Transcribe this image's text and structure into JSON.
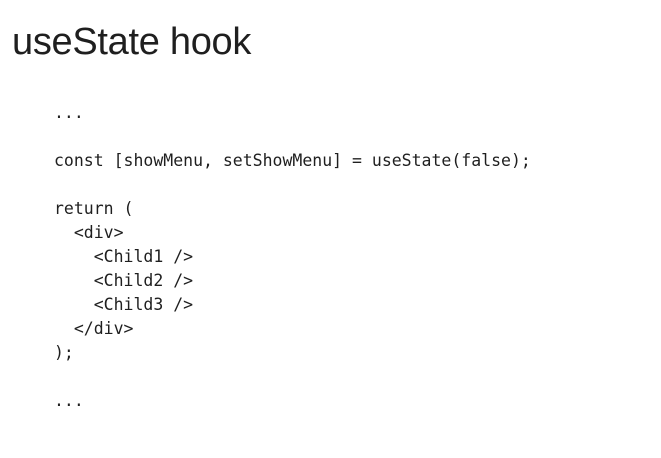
{
  "slide": {
    "title": "useState hook",
    "code_lines": [
      "...",
      "",
      "const [showMenu, setShowMenu] = useState(false);",
      "",
      "return (",
      "  <div>",
      "    <Child1 />",
      "    <Child2 />",
      "    <Child3 />",
      "  </div>",
      ");",
      "",
      "..."
    ]
  }
}
